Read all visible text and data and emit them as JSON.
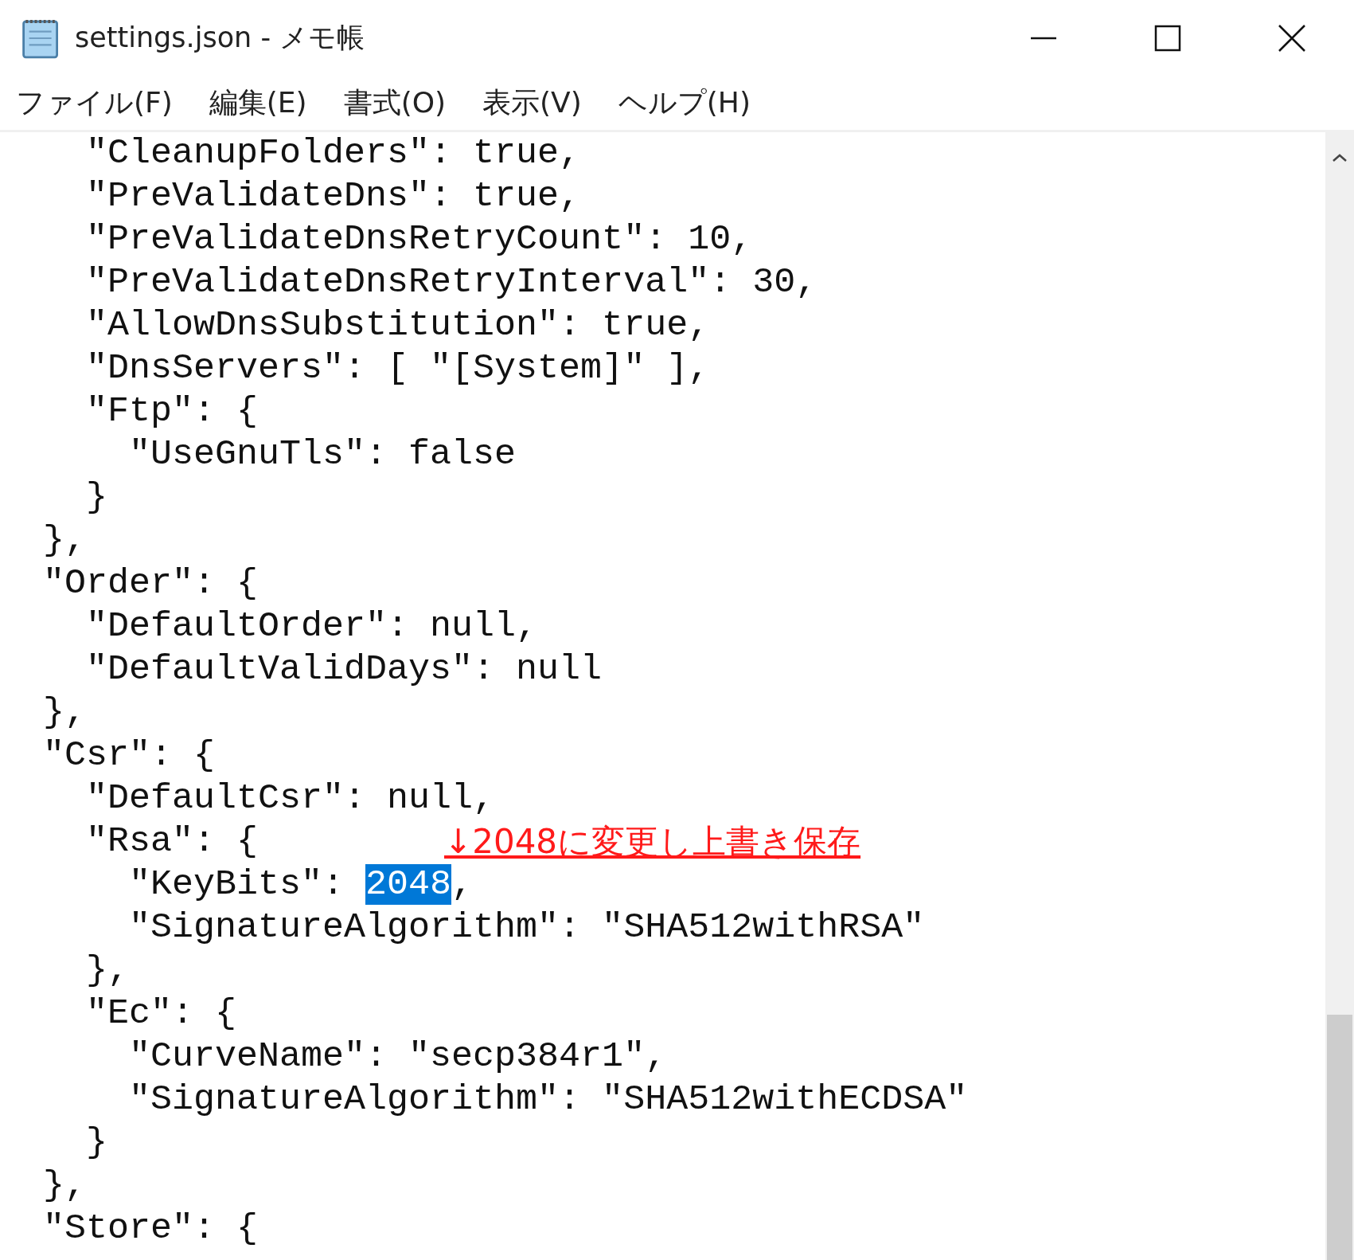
{
  "window": {
    "title": "settings.json - メモ帳"
  },
  "menu": [
    {
      "label": "ファイル(F)"
    },
    {
      "label": "編集(E)"
    },
    {
      "label": "書式(O)"
    },
    {
      "label": "表示(V)"
    },
    {
      "label": "ヘルプ(H)"
    }
  ],
  "lines": [
    {
      "segments": [
        {
          "text": "    \"CleanupFolders\": true,",
          "selected": false
        }
      ]
    },
    {
      "segments": [
        {
          "text": "    \"PreValidateDns\": true,",
          "selected": false
        }
      ]
    },
    {
      "segments": [
        {
          "text": "    \"PreValidateDnsRetryCount\": 10,",
          "selected": false
        }
      ]
    },
    {
      "segments": [
        {
          "text": "    \"PreValidateDnsRetryInterval\": 30,",
          "selected": false
        }
      ]
    },
    {
      "segments": [
        {
          "text": "    \"AllowDnsSubstitution\": true,",
          "selected": false
        }
      ]
    },
    {
      "segments": [
        {
          "text": "    \"DnsServers\": [ \"[System]\" ],",
          "selected": false
        }
      ]
    },
    {
      "segments": [
        {
          "text": "    \"Ftp\": {",
          "selected": false
        }
      ]
    },
    {
      "segments": [
        {
          "text": "      \"UseGnuTls\": false",
          "selected": false
        }
      ]
    },
    {
      "segments": [
        {
          "text": "    }",
          "selected": false
        }
      ]
    },
    {
      "segments": [
        {
          "text": "  },",
          "selected": false
        }
      ]
    },
    {
      "segments": [
        {
          "text": "  \"Order\": {",
          "selected": false
        }
      ]
    },
    {
      "segments": [
        {
          "text": "    \"DefaultOrder\": null,",
          "selected": false
        }
      ]
    },
    {
      "segments": [
        {
          "text": "    \"DefaultValidDays\": null",
          "selected": false
        }
      ]
    },
    {
      "segments": [
        {
          "text": "  },",
          "selected": false
        }
      ]
    },
    {
      "segments": [
        {
          "text": "  \"Csr\": {",
          "selected": false
        }
      ]
    },
    {
      "segments": [
        {
          "text": "    \"DefaultCsr\": null,",
          "selected": false
        }
      ]
    },
    {
      "segments": [
        {
          "text": "    \"Rsa\": {",
          "selected": false
        }
      ],
      "annotation": "↓2048に変更し上書き保存"
    },
    {
      "segments": [
        {
          "text": "      \"KeyBits\": ",
          "selected": false
        },
        {
          "text": "2048",
          "selected": true
        },
        {
          "text": ",",
          "selected": false
        }
      ]
    },
    {
      "segments": [
        {
          "text": "      \"SignatureAlgorithm\": \"SHA512withRSA\"",
          "selected": false
        }
      ]
    },
    {
      "segments": [
        {
          "text": "    },",
          "selected": false
        }
      ]
    },
    {
      "segments": [
        {
          "text": "    \"Ec\": {",
          "selected": false
        }
      ]
    },
    {
      "segments": [
        {
          "text": "      \"CurveName\": \"secp384r1\",",
          "selected": false
        }
      ]
    },
    {
      "segments": [
        {
          "text": "      \"SignatureAlgorithm\": \"SHA512withECDSA\"",
          "selected": false
        }
      ]
    },
    {
      "segments": [
        {
          "text": "    }",
          "selected": false
        }
      ]
    },
    {
      "segments": [
        {
          "text": "  },",
          "selected": false
        }
      ]
    },
    {
      "segments": [
        {
          "text": "  \"Store\": {",
          "selected": false
        }
      ]
    }
  ]
}
